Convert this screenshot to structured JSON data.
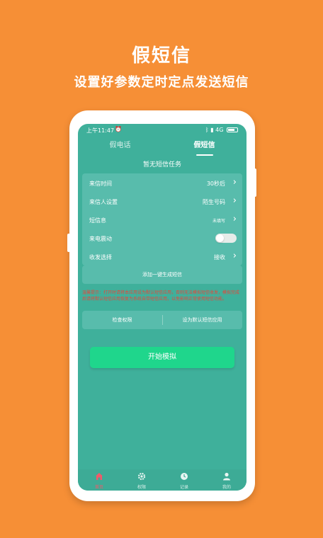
{
  "promo": {
    "title": "假短信",
    "subtitle": "设置好参数定时定点发送短信"
  },
  "status_bar": {
    "time": "上午11:47",
    "network": "4G"
  },
  "tabs": [
    {
      "label": "假电话",
      "active": false
    },
    {
      "label": "假短信",
      "active": true
    }
  ],
  "panel": {
    "header": "暂无短信任务",
    "rows": [
      {
        "label": "来信时间",
        "value": "30秒后"
      },
      {
        "label": "来信人设置",
        "value": "陌生号码"
      },
      {
        "label": "短信息",
        "value": "未填写"
      },
      {
        "label": "来电震动",
        "toggle": false
      },
      {
        "label": "收发选择",
        "value": "接收"
      }
    ],
    "generate_button": "添加一键生成短信",
    "warning": "温馨提示：打开时请将本应用设为默认短信应用，否则无法模拟短信收发，模拟完成后请将默认短信应用恢复为系统自带短信应用，以免影响正常使用短信功能。",
    "permission_button": "检查权限",
    "default_app_button": "设为默认短信应用",
    "start_button": "开始模拟"
  },
  "bottom_nav": [
    {
      "label": "首页",
      "icon": "home-icon",
      "active": true
    },
    {
      "label": "权限",
      "icon": "gear-icon",
      "active": false
    },
    {
      "label": "记录",
      "icon": "clock-icon",
      "active": false
    },
    {
      "label": "我的",
      "icon": "person-icon",
      "active": false
    }
  ],
  "colors": {
    "background": "#f68f36",
    "screen": "#3fb09b",
    "card": "#58bcac",
    "start_button": "#1fd68c",
    "warning": "#e8453a",
    "nav_active": "#f05a6a"
  }
}
